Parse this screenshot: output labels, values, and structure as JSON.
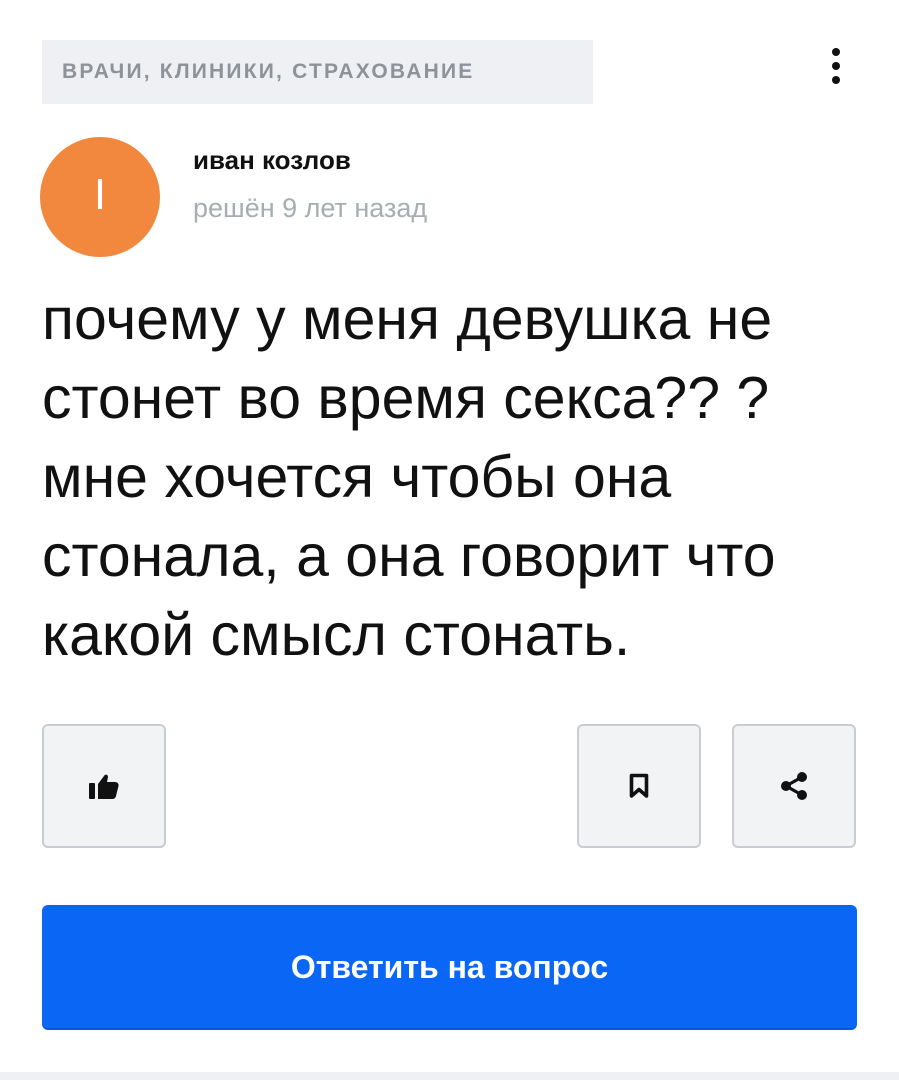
{
  "header": {
    "category_label": "ВРАЧИ, КЛИНИКИ, СТРАХОВАНИЕ",
    "menu_icon": "more-vertical-icon"
  },
  "author": {
    "avatar_letter": "I",
    "avatar_color": "#f2883e",
    "name": "иван козлов",
    "status": "решён 9 лет назад"
  },
  "question": {
    "text": "почему у меня девушка не стонет во время секса?? ? мне хочется чтобы она стонала, а она говорит что какой смысл стонать."
  },
  "actions": {
    "like_icon": "thumbs-up-icon",
    "bookmark_icon": "bookmark-icon",
    "share_icon": "share-icon",
    "answer_label": "Ответить на вопрос",
    "answer_color": "#0a66f5"
  }
}
